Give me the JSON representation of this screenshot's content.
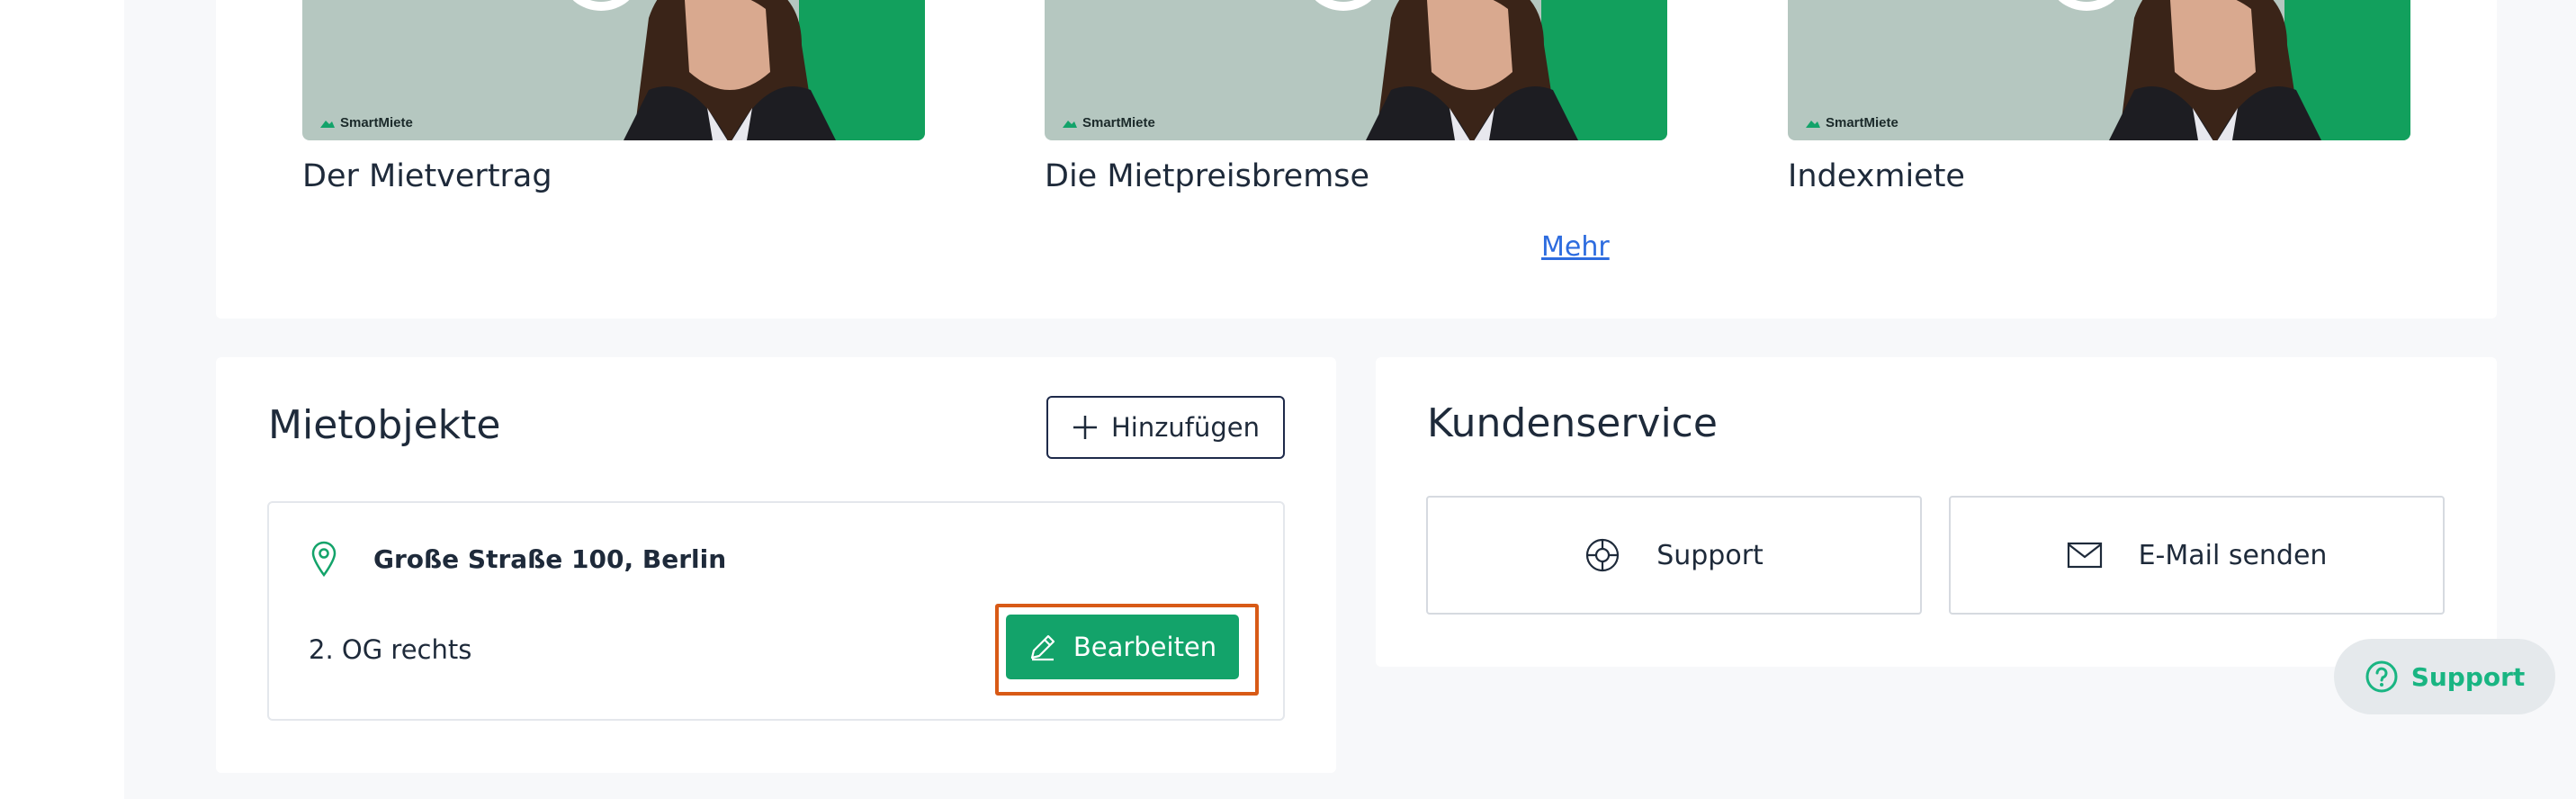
{
  "videos": {
    "items": [
      {
        "title": "Der Mietvertrag",
        "brand": "SmartMiete"
      },
      {
        "title": "Die Mietpreisbremse",
        "brand": "SmartMiete"
      },
      {
        "title": "Indexmiete",
        "brand": "SmartMiete"
      }
    ],
    "more_label": "Mehr"
  },
  "mietobjekte": {
    "title": "Mietobjekte",
    "add_label": "Hinzufügen",
    "property": {
      "address": "Große Straße 100, Berlin",
      "floor": "2. OG rechts",
      "edit_label": "Bearbeiten"
    }
  },
  "kundenservice": {
    "title": "Kundenservice",
    "support_label": "Support",
    "email_label": "E-Mail senden"
  },
  "floating_support": {
    "label": "Support"
  },
  "colors": {
    "accent_green": "#13a36a",
    "support_green": "#19b582",
    "link_blue": "#2d6cdf",
    "highlight_orange": "#d85a16",
    "text_dark": "#1e2a3a"
  }
}
